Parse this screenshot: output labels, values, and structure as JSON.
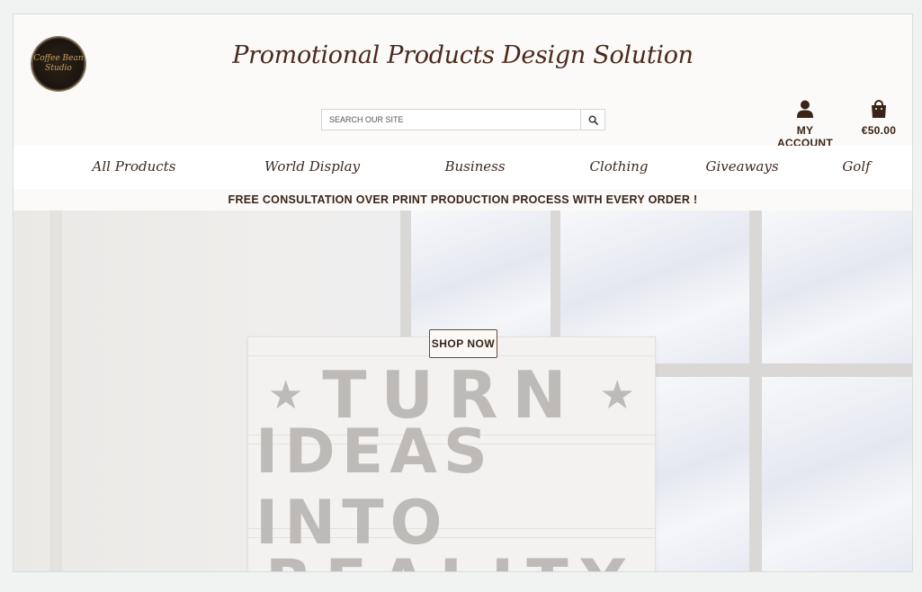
{
  "header": {
    "logo_text_line1": "Coffee Bean",
    "logo_text_line2": "Studio",
    "title": "Promotional Products Design Solution",
    "search_placeholder": "SEARCH OUR SITE",
    "account_label": "MY ACCOUNT",
    "cart_total": "€50.00",
    "icons": [
      "search-icon",
      "user-icon",
      "shopping-bag-icon"
    ]
  },
  "nav": {
    "items": [
      {
        "label": "All Products"
      },
      {
        "label": "World Display"
      },
      {
        "label": "Business"
      },
      {
        "label": "Clothing"
      },
      {
        "label": "Giveaways"
      },
      {
        "label": "Golf"
      }
    ]
  },
  "banner": {
    "text": "FREE CONSULTATION OVER PRINT PRODUCTION PROCESS WITH EVERY ORDER !"
  },
  "hero": {
    "button_label": "SHOP NOW",
    "board_line1": "TURN",
    "board_line2": "IDEAS INTO",
    "board_line3": "REALITY"
  },
  "colors": {
    "brand_brown": "#3a2416",
    "background": "#fbfaf8",
    "nav_background": "#ffffff"
  }
}
